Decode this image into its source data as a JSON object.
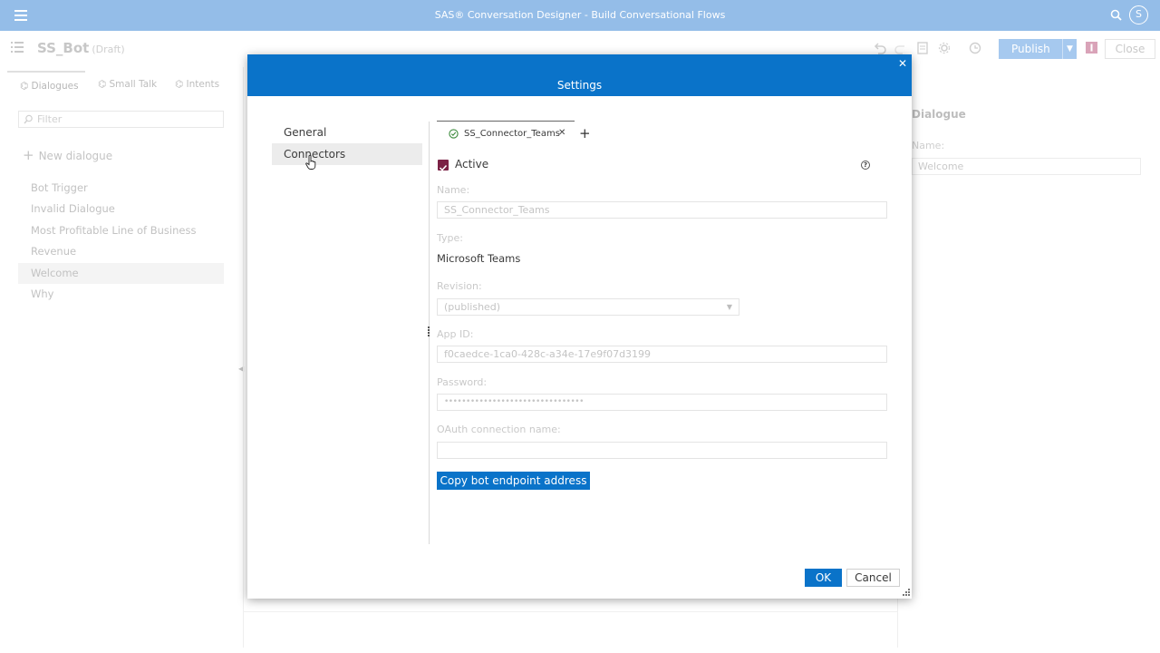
{
  "topbar": {
    "title": "SAS® Conversation Designer - Build Conversational Flows",
    "avatar_letter": "S"
  },
  "toolbar": {
    "bot_name": "SS_Bot",
    "bot_status": "(Draft)",
    "publish_label": "Publish",
    "close_label": "Close"
  },
  "left_pane": {
    "tabs": [
      {
        "label": "Dialogues"
      },
      {
        "label": "Small Talk"
      },
      {
        "label": "Intents"
      }
    ],
    "filter_placeholder": "Filter",
    "new_dialogue_label": "New dialogue",
    "dialogues": [
      {
        "label": "Bot Trigger"
      },
      {
        "label": "Invalid Dialogue"
      },
      {
        "label": "Most Profitable Line of Business"
      },
      {
        "label": "Revenue"
      },
      {
        "label": "Welcome"
      },
      {
        "label": "Why"
      }
    ]
  },
  "right_pane": {
    "title": "Dialogue",
    "name_label": "Name:",
    "name_value": "Welcome"
  },
  "modal": {
    "title": "Settings",
    "nav": [
      {
        "label": "General"
      },
      {
        "label": "Connectors"
      }
    ],
    "connector_tab_label": "SS_Connector_Teams",
    "active_label": "Active",
    "fields": {
      "name_label": "Name:",
      "name_value": "SS_Connector_Teams",
      "type_label": "Type:",
      "type_value": "Microsoft Teams",
      "revision_label": "Revision:",
      "revision_value": "(published)",
      "appid_label": "App ID:",
      "appid_value": "f0caedce-1ca0-428c-a34e-17e9f07d3199",
      "password_label": "Password:",
      "password_value": "••••••••••••••••••••••••••••••••",
      "oauth_label": "OAuth connection name:",
      "oauth_value": ""
    },
    "copy_button_label": "Copy bot endpoint address",
    "ok_label": "OK",
    "cancel_label": "Cancel"
  },
  "colors": {
    "header_blue": "#0a73c9",
    "topbar_blue": "#94bde8",
    "checkbox": "#7b2145"
  }
}
